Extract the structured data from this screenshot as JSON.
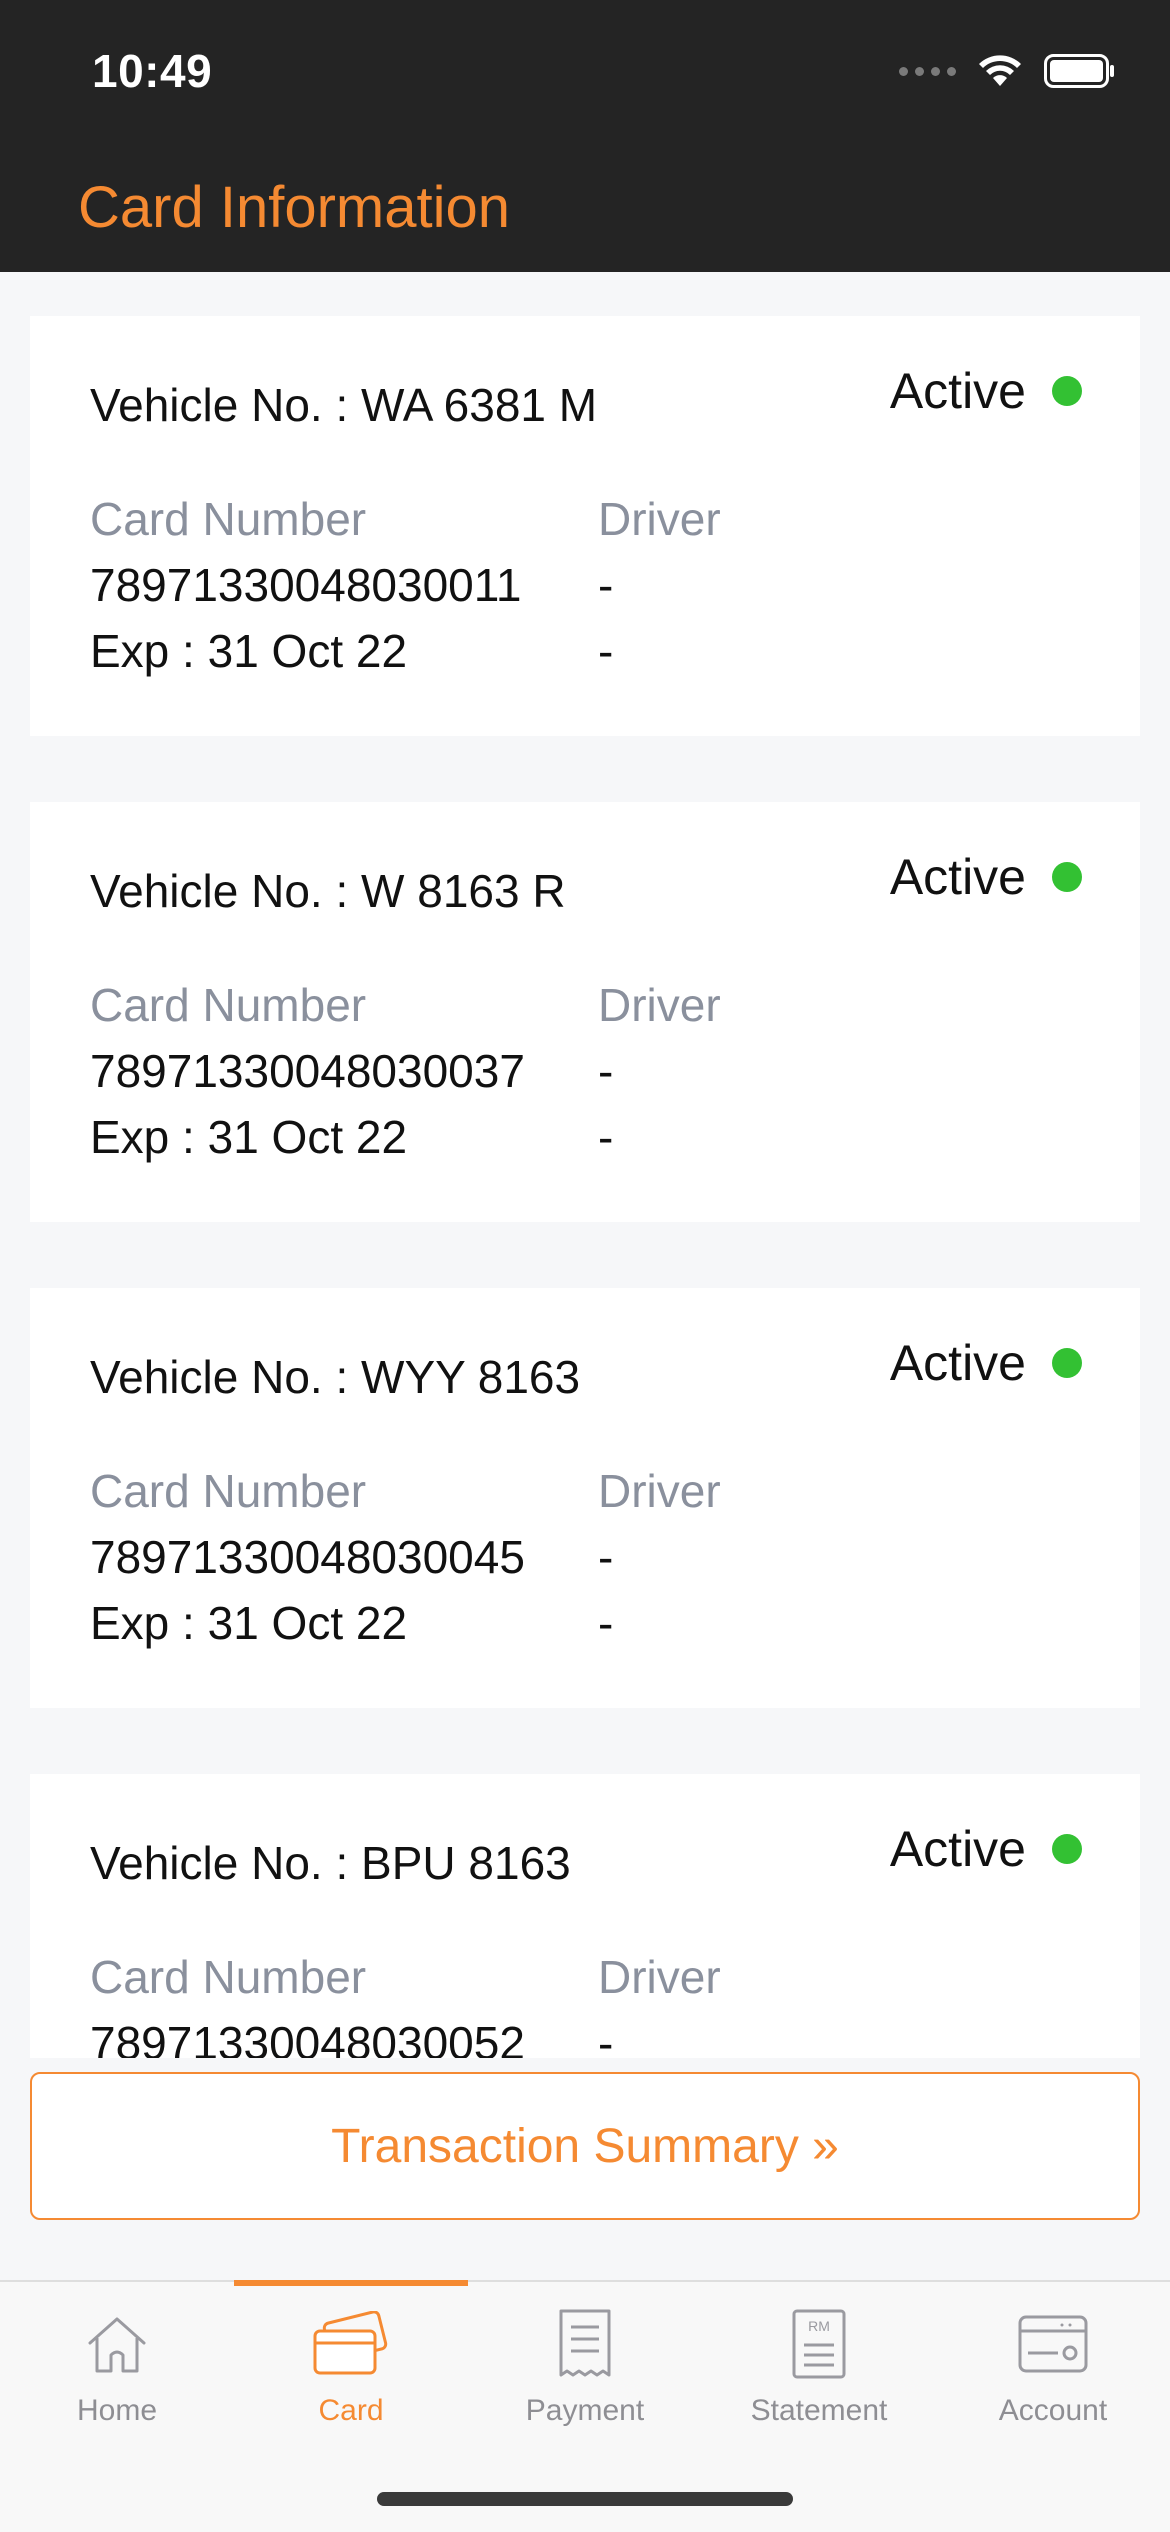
{
  "status_bar": {
    "time": "10:49"
  },
  "header": {
    "title": "Card Information"
  },
  "labels": {
    "card_number": "Card Number",
    "driver": "Driver"
  },
  "cards": [
    {
      "vehicle": "Vehicle No. : WA 6381 M",
      "status": "Active",
      "card_number": "78971330048030011",
      "expiry": "Exp : 31 Oct 22",
      "driver_line1": "-",
      "driver_line2": "-"
    },
    {
      "vehicle": "Vehicle No. : W 8163 R",
      "status": "Active",
      "card_number": "78971330048030037",
      "expiry": "Exp : 31 Oct 22",
      "driver_line1": "-",
      "driver_line2": "-"
    },
    {
      "vehicle": "Vehicle No. : WYY 8163",
      "status": "Active",
      "card_number": "78971330048030045",
      "expiry": "Exp : 31 Oct 22",
      "driver_line1": "-",
      "driver_line2": "-"
    },
    {
      "vehicle": "Vehicle No. : BPU 8163",
      "status": "Active",
      "card_number": "78971330048030052",
      "expiry": "",
      "driver_line1": "-",
      "driver_line2": ""
    }
  ],
  "summary_button": {
    "label": "Transaction Summary »"
  },
  "tabs": [
    {
      "label": "Home",
      "icon": "home-icon"
    },
    {
      "label": "Card",
      "icon": "card-icon",
      "active": true
    },
    {
      "label": "Payment",
      "icon": "receipt-icon"
    },
    {
      "label": "Statement",
      "icon": "statement-icon",
      "badge": "RM"
    },
    {
      "label": "Account",
      "icon": "account-icon"
    }
  ],
  "colors": {
    "accent": "#f58a32",
    "header_bg": "#242424",
    "active_dot": "#33c133",
    "muted_text": "#8a909d"
  }
}
